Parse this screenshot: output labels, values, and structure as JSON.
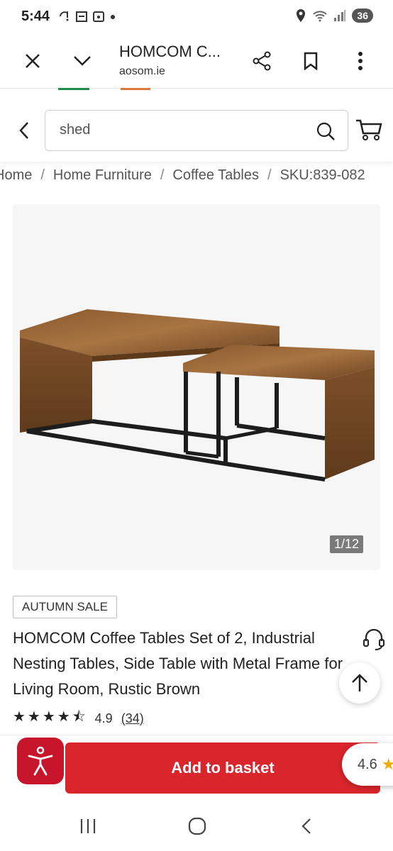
{
  "status_bar": {
    "time": "5:44",
    "battery": "36"
  },
  "browser": {
    "title": "HOMCOM C...",
    "url": "aosom.ie"
  },
  "search": {
    "value": "shed"
  },
  "breadcrumb": [
    "Home",
    "Home Furniture",
    "Coffee Tables",
    "SKU:839-082"
  ],
  "gallery": {
    "counter": "1/12"
  },
  "product": {
    "sale_tag": "AUTUMN SALE",
    "title": "HOMCOM Coffee Tables Set of 2, Industrial Nesting Tables, Side Table with Metal Frame for Living Room, Rustic Brown",
    "rating_stars": "★★★★⯪",
    "rating_value": "4.9",
    "review_count": "(34)"
  },
  "actions": {
    "add_to_basket": "Add to basket",
    "review_score": "4.6"
  },
  "colors": {
    "accent": "#d9252b",
    "access": "#c7162b",
    "review_star": "#f2a900"
  }
}
